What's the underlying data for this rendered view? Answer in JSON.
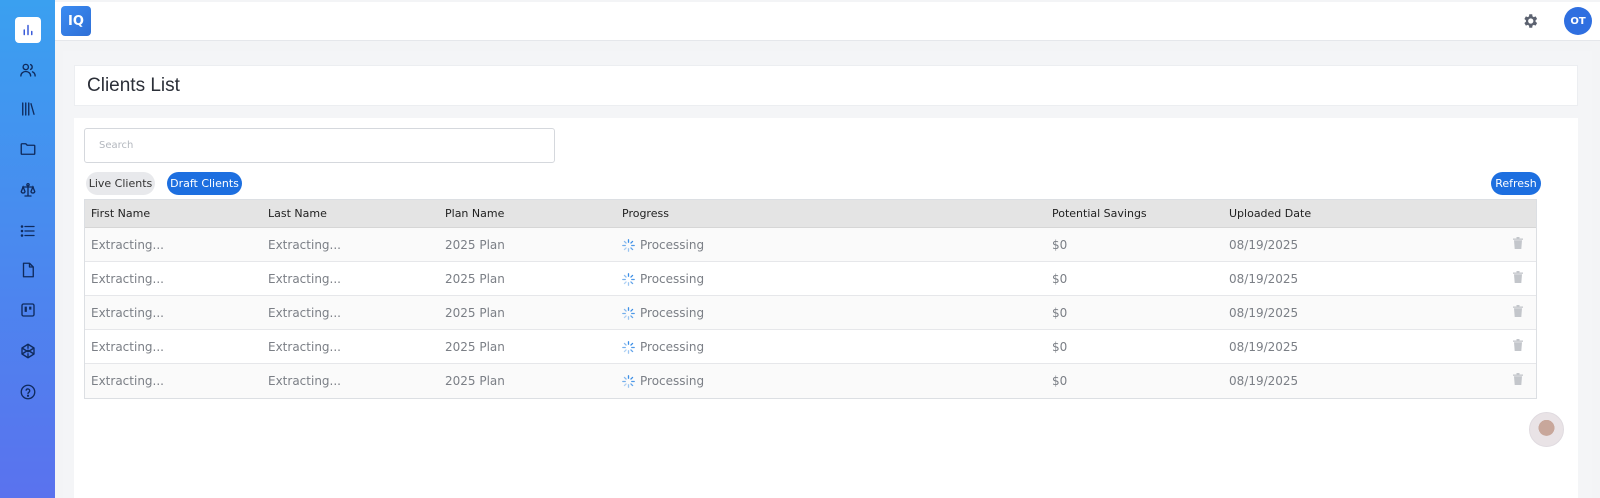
{
  "app": {
    "logo_text": "IQ",
    "user_initials": "OT"
  },
  "sidebar": {
    "items": [
      {
        "icon": "bar-chart-icon",
        "active": true
      },
      {
        "icon": "users-icon"
      },
      {
        "icon": "library-icon"
      },
      {
        "icon": "folder-icon"
      },
      {
        "icon": "scale-icon"
      },
      {
        "icon": "list-icon"
      },
      {
        "icon": "file-icon"
      },
      {
        "icon": "kanban-icon"
      },
      {
        "icon": "codepen-icon"
      },
      {
        "icon": "help-icon"
      }
    ]
  },
  "page": {
    "title": "Clients List"
  },
  "search": {
    "placeholder": "Search",
    "value": ""
  },
  "filters": {
    "live_label": "Live Clients",
    "draft_label": "Draft Clients",
    "active": "Draft Clients"
  },
  "actions": {
    "refresh_label": "Refresh"
  },
  "table": {
    "columns": [
      "First Name",
      "Last Name",
      "Plan Name",
      "Progress",
      "Potential Savings",
      "Uploaded Date"
    ],
    "rows": [
      {
        "first_name": "Extracting...",
        "last_name": "Extracting...",
        "plan": "2025 Plan",
        "progress": "Processing",
        "savings": "$0",
        "date": "08/19/2025"
      },
      {
        "first_name": "Extracting...",
        "last_name": "Extracting...",
        "plan": "2025 Plan",
        "progress": "Processing",
        "savings": "$0",
        "date": "08/19/2025"
      },
      {
        "first_name": "Extracting...",
        "last_name": "Extracting...",
        "plan": "2025 Plan",
        "progress": "Processing",
        "savings": "$0",
        "date": "08/19/2025"
      },
      {
        "first_name": "Extracting...",
        "last_name": "Extracting...",
        "plan": "2025 Plan",
        "progress": "Processing",
        "savings": "$0",
        "date": "08/19/2025"
      },
      {
        "first_name": "Extracting...",
        "last_name": "Extracting...",
        "plan": "2025 Plan",
        "progress": "Processing",
        "savings": "$0",
        "date": "08/19/2025"
      }
    ]
  },
  "colors": {
    "accent": "#1d6fe0",
    "sidebar_top": "#3aa0f0",
    "sidebar_bottom": "#5a72ee"
  }
}
